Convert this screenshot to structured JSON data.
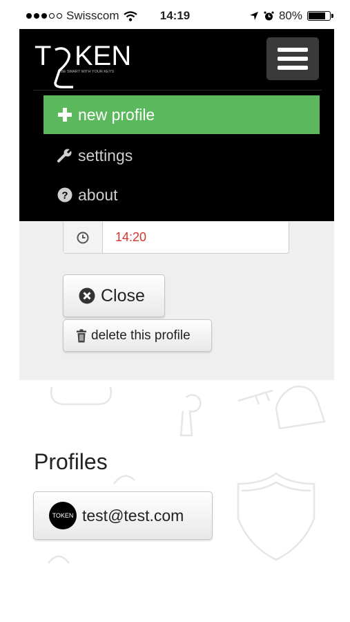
{
  "status_bar": {
    "carrier": "Swisscom",
    "time": "14:19",
    "battery": "80%",
    "battery_level": 0.8
  },
  "navbar": {
    "logo_text": "TOKEN",
    "logo_tagline": "BE SMART WITH YOUR KEYS",
    "items": [
      {
        "label": "new profile",
        "icon": "plus-icon"
      },
      {
        "label": "settings",
        "icon": "wrench-icon"
      },
      {
        "label": "about",
        "icon": "question-circle-icon"
      }
    ]
  },
  "form": {
    "time_value": "14:20",
    "time_icon": "clock-icon"
  },
  "actions": {
    "close_label": "Close",
    "delete_label": "delete this profile"
  },
  "profiles": {
    "title": "Profiles",
    "items": [
      {
        "email": "test@test.com",
        "avatar_text": "TOKEN"
      }
    ]
  },
  "colors": {
    "accent_green": "#5cb85c",
    "time_red": "#d9342b",
    "nav_bg": "#000000"
  }
}
